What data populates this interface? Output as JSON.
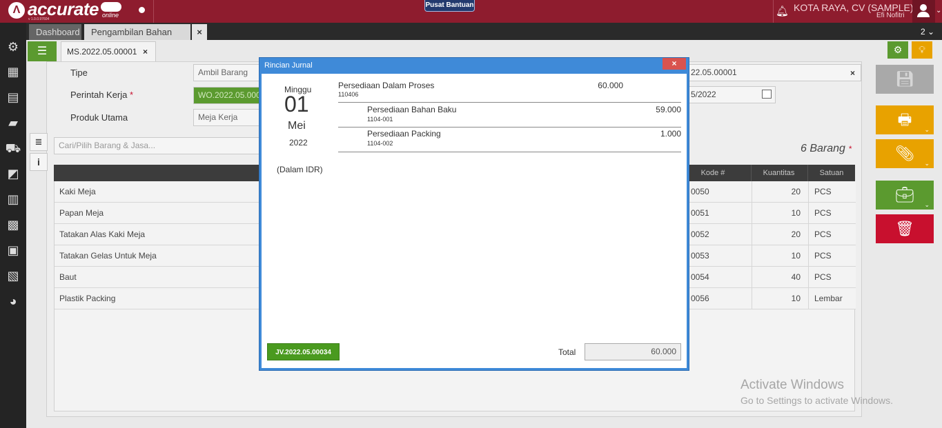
{
  "app": {
    "logo_text": "accurate",
    "logo_sub": "online",
    "logo_version": "v 1.0.0.97604",
    "help_label": "Pusat Bantuan",
    "company": "KOTA RAYA, CV (SAMPLE)",
    "user": "Efi Nofitri"
  },
  "tabs": {
    "dashboard": "Dashboard",
    "active": "Pengambilan Bahan Baku",
    "close": "×",
    "count": "2 ⌄"
  },
  "sidebar": {
    "icons": [
      "settings-icon",
      "company-icon",
      "ledger-icon",
      "cash-icon",
      "purchase-icon",
      "sales-icon",
      "inventory-icon",
      "manufacturing-icon",
      "logistics-icon",
      "fixed-asset-icon",
      "report-icon"
    ]
  },
  "document": {
    "number": "MS.2022.05.00001",
    "close": "×",
    "fields": {
      "tipe_label": "Tipe",
      "tipe_value": "Ambil Barang",
      "perintah_label": "Perintah Kerja",
      "perintah_value": "WO.2022.05.000",
      "produk_label": "Produk Utama",
      "produk_value": "Meja Kerja Porta"
    },
    "right_fields": {
      "number_value": "22.05.00001",
      "date_value": "5/2022"
    },
    "search_placeholder": "Cari/Pilih Barang & Jasa...",
    "item_count": "6 Barang"
  },
  "table": {
    "headers": {
      "kode": "Kode #",
      "qty": "Kuantitas",
      "unit": "Satuan"
    },
    "rows": [
      {
        "name": "Kaki Meja",
        "kode": "0050",
        "qty": "20",
        "unit": "PCS"
      },
      {
        "name": "Papan Meja",
        "kode": "0051",
        "qty": "10",
        "unit": "PCS"
      },
      {
        "name": "Tatakan Alas Kaki Meja",
        "kode": "0052",
        "qty": "20",
        "unit": "PCS"
      },
      {
        "name": "Tatakan Gelas Untuk Meja",
        "kode": "0053",
        "qty": "10",
        "unit": "PCS"
      },
      {
        "name": "Baut",
        "kode": "0054",
        "qty": "40",
        "unit": "PCS"
      },
      {
        "name": "Plastik Packing",
        "kode": "0056",
        "qty": "10",
        "unit": "Lembar"
      }
    ]
  },
  "dialog": {
    "title": "Rincian Jurnal",
    "close": "×",
    "day": "Minggu",
    "date": "01",
    "month": "Mei",
    "year": "2022",
    "currency": "(Dalam IDR)",
    "entries": [
      {
        "name": "Persediaan Dalam Proses",
        "code": "110406",
        "debit": "60.000",
        "credit": ""
      },
      {
        "name": "Persediaan Bahan Baku",
        "code": "1104-001",
        "debit": "",
        "credit": "59.000"
      },
      {
        "name": "Persediaan Packing",
        "code": "1104-002",
        "debit": "",
        "credit": "1.000"
      }
    ],
    "jv_button": "JV.2022.05.00034",
    "total_label": "Total",
    "total_value": "60.000"
  },
  "watermark": {
    "line1": "Activate Windows",
    "line2": "Go to Settings to activate Windows."
  },
  "colors": {
    "brand": "#8e1c2e",
    "green": "#5b9a2f",
    "orange": "#e8a200",
    "red": "#c8102e",
    "dialog_blue": "#3f8ad8"
  }
}
